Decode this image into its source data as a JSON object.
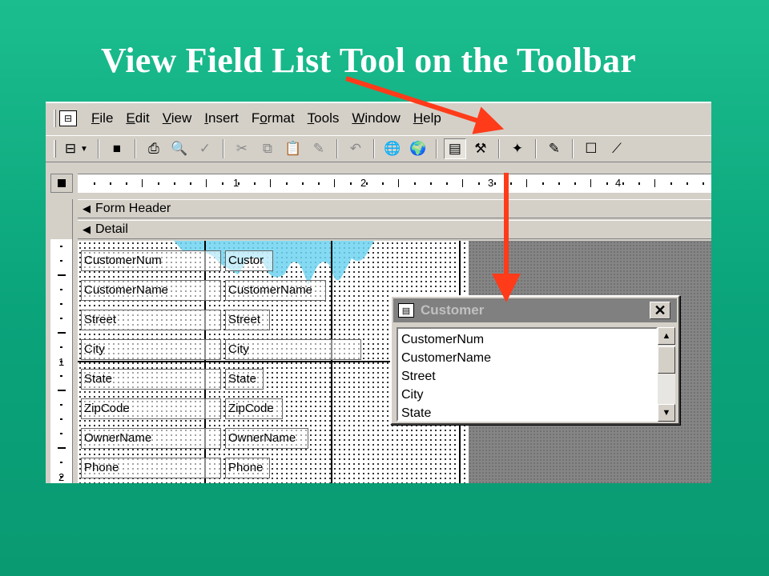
{
  "slide": {
    "title": "View Field List Tool on the Toolbar"
  },
  "menubar": {
    "items": [
      "File",
      "Edit",
      "View",
      "Insert",
      "Format",
      "Tools",
      "Window",
      "Help"
    ],
    "underlines": [
      "F",
      "E",
      "V",
      "I",
      "o",
      "T",
      "W",
      "H"
    ]
  },
  "toolbar": {
    "buttons": [
      {
        "icon": "form-view-icon",
        "glyph": "⊟"
      },
      {
        "icon": "save-icon",
        "glyph": "■"
      },
      {
        "icon": "print-icon",
        "glyph": "⎙"
      },
      {
        "icon": "print-preview-icon",
        "glyph": "🔍"
      },
      {
        "icon": "spelling-icon",
        "glyph": "✓"
      },
      {
        "icon": "cut-icon",
        "glyph": "✂"
      },
      {
        "icon": "copy-icon",
        "glyph": "⧉"
      },
      {
        "icon": "paste-icon",
        "glyph": "📋"
      },
      {
        "icon": "format-painter-icon",
        "glyph": "✎"
      },
      {
        "icon": "undo-icon",
        "glyph": "↶"
      },
      {
        "icon": "insert-hyperlink-icon",
        "glyph": "🌐"
      },
      {
        "icon": "web-toolbar-icon",
        "glyph": "🌍"
      },
      {
        "icon": "field-list-icon",
        "glyph": "▤"
      },
      {
        "icon": "toolbox-icon",
        "glyph": "⚒"
      },
      {
        "icon": "autoformat-icon",
        "glyph": "✦"
      },
      {
        "icon": "code-icon",
        "glyph": "✎"
      },
      {
        "icon": "properties-icon",
        "glyph": "☐"
      },
      {
        "icon": "build-icon",
        "glyph": "⟋"
      }
    ]
  },
  "ruler": {
    "numbers": [
      "1",
      "2",
      "3",
      "4"
    ]
  },
  "sections": {
    "form_header": "Form Header",
    "detail": "Detail"
  },
  "vertical_ruler": {
    "numbers": [
      "1",
      "2"
    ]
  },
  "form_fields": {
    "labels": [
      "CustomerNum",
      "CustomerName",
      "Street",
      "City",
      "State",
      "ZipCode",
      "OwnerName",
      "Phone"
    ],
    "textboxes": [
      "Custor",
      "CustomerName",
      "Street",
      "City",
      "State",
      "ZipCode",
      "OwnerName",
      "Phone"
    ]
  },
  "field_list": {
    "title": "Customer",
    "close_glyph": "✕",
    "items": [
      "CustomerNum",
      "CustomerName",
      "Street",
      "City",
      "State"
    ]
  },
  "colors": {
    "background": "#12b283",
    "arrow": "#ff3b1a",
    "highlight": "#6fd3f0"
  }
}
